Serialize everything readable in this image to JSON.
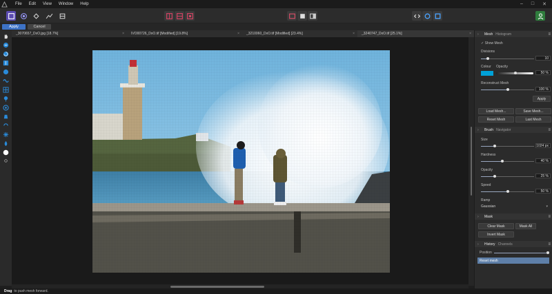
{
  "menu": {
    "items": [
      "File",
      "Edit",
      "View",
      "Window",
      "Help"
    ]
  },
  "context_toolbar": {
    "apply_label": "Apply",
    "cancel_label": "Cancel"
  },
  "tabs": [
    {
      "label": "_3070657_DxO.jpg [18.7%]"
    },
    {
      "label": "IVO00726_DxO.tif [Modified] [19.8%]"
    },
    {
      "label": "_3210060_DxO.tif [Modified] [23.4%]"
    },
    {
      "label": "_3240747_DxO.tif [25.1%]"
    }
  ],
  "status": {
    "bold": "Drag",
    "text": "to push mesh forward."
  },
  "panel": {
    "mesh": {
      "tab_active": "Mesh",
      "tab_other": "Histogram",
      "show_mesh": "Show Mesh",
      "divisions_label": "Divisions",
      "divisions_value": "10",
      "colour_label": "Colour",
      "opacity_label": "Opacity",
      "opacity_value": "50 %",
      "reconstruct_label": "Reconstruct Mesh",
      "reconstruct_value": "100 %",
      "apply_label": "Apply",
      "load_mesh": "Load Mesh...",
      "save_mesh": "Save Mesh...",
      "reset_mesh": "Reset Mesh",
      "last_mesh": "Last Mesh",
      "colour_hex": "#00a1d8"
    },
    "brush": {
      "tab_active": "Brush",
      "tab_other": "Navigator",
      "size_label": "Size",
      "size_value": "1024 px",
      "hardness_label": "Hardness",
      "hardness_value": "40 %",
      "opacity_label": "Opacity",
      "opacity_value": "25 %",
      "speed_label": "Speed",
      "speed_value": "50 %",
      "ramp_label": "Ramp",
      "ramp_value": "Gaussian"
    },
    "mask": {
      "title": "Mask",
      "clear_mask": "Clear Mask",
      "mask_all": "Mask All",
      "invert_mask": "Invert Mask"
    },
    "history": {
      "tab_active": "History",
      "tab_other": "Channels",
      "position_label": "Position",
      "row_label": "Reset mesh"
    }
  },
  "colors": {
    "accent": "#3d72c5",
    "history_highlight": "#5e7fa8"
  }
}
